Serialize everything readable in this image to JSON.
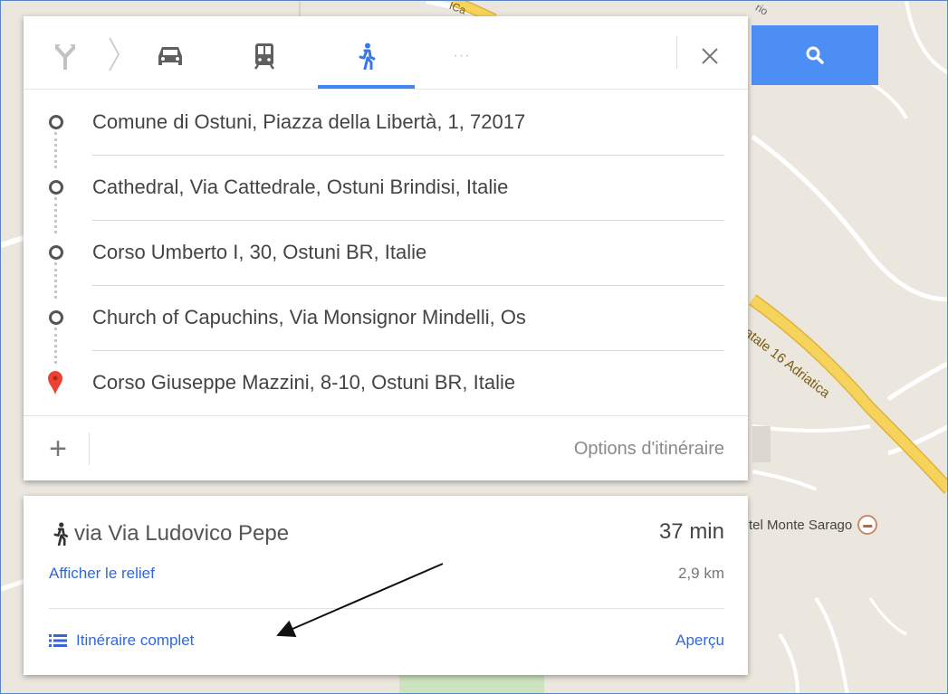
{
  "travel_modes": {
    "items": [
      {
        "name": "best-route",
        "icon": "route-split-icon"
      },
      {
        "name": "car",
        "icon": "car-icon"
      },
      {
        "name": "transit",
        "icon": "train-icon"
      },
      {
        "name": "walk",
        "icon": "walk-icon",
        "selected": true
      },
      {
        "name": "more",
        "icon": "more-dots-icon"
      }
    ],
    "more_label": "···"
  },
  "waypoints": [
    {
      "text": "Comune di Ostuni, Piazza della Libertà, 1, 72017",
      "marker": "circle"
    },
    {
      "text": "Cathedral, Via Cattedrale, Ostuni Brindisi, Italie",
      "marker": "circle"
    },
    {
      "text": "Corso Umberto I, 30, Ostuni BR, Italie",
      "marker": "circle"
    },
    {
      "text": "Church of Capuchins, Via Monsignor Mindelli, Os",
      "marker": "circle"
    },
    {
      "text": "Corso Giuseppe Mazzini, 8-10, Ostuni BR, Italie",
      "marker": "pin"
    }
  ],
  "add_destination": {
    "label": "+"
  },
  "route_options": {
    "label": "Options d'itinéraire"
  },
  "route": {
    "via": "via Via Ludovico Pepe",
    "duration": "37 min",
    "relief_link": "Afficher le relief",
    "distance": "2,9 km",
    "full_route_link": "Itinéraire complet",
    "preview_link": "Aperçu"
  },
  "map": {
    "poi_label": "tel Monte Sarago",
    "road_label": "atale 16 Adriatica",
    "road_label_top": "ICa",
    "road_label_top_right": "rio"
  },
  "colors": {
    "accent": "#4285f4",
    "search_button": "#4d8ef5",
    "link": "#3367d6",
    "pin": "#ea4335",
    "road_major": "#f2c94c",
    "map_bg": "#e9e5dc"
  }
}
